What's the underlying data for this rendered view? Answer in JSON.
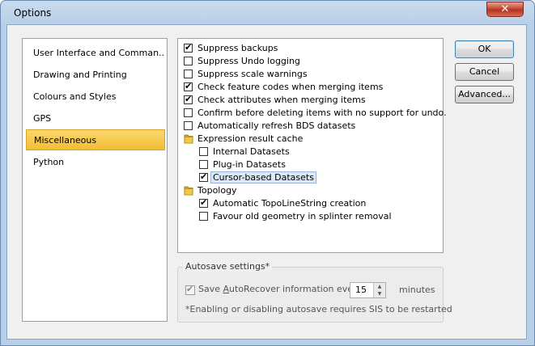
{
  "window": {
    "title": "Options",
    "close_glyph": "✕"
  },
  "nav": {
    "items": [
      {
        "label": "User Interface and Comman..."
      },
      {
        "label": "Drawing and Printing"
      },
      {
        "label": "Colours and Styles"
      },
      {
        "label": "GPS"
      },
      {
        "label": "Miscellaneous",
        "selected": true
      },
      {
        "label": "Python"
      }
    ]
  },
  "options": {
    "suppress_backups": {
      "label": "Suppress backups",
      "checked": true
    },
    "suppress_undo": {
      "label": "Suppress Undo logging",
      "checked": false
    },
    "suppress_scale": {
      "label": "Suppress scale warnings",
      "checked": false
    },
    "check_feature_codes": {
      "label": "Check feature codes when merging items",
      "checked": true
    },
    "check_attributes": {
      "label": "Check attributes when merging items",
      "checked": true
    },
    "confirm_delete": {
      "label": "Confirm before deleting items with no support for undo.",
      "checked": false
    },
    "refresh_bds": {
      "label": "Automatically refresh BDS datasets",
      "checked": false
    },
    "expression_cache": {
      "label": "Expression result cache",
      "icon": "folder-icon",
      "children": {
        "internal": {
          "label": "Internal Datasets",
          "checked": false
        },
        "plugin": {
          "label": "Plug-in Datasets",
          "checked": false
        },
        "cursor": {
          "label": "Cursor-based Datasets",
          "checked": true
        }
      }
    },
    "topology": {
      "label": "Topology",
      "icon": "folder-icon",
      "children": {
        "auto_topo": {
          "label": "Automatic TopoLineString creation",
          "checked": true
        },
        "favour_old": {
          "label": "Favour old geometry in splinter removal",
          "checked": false
        }
      }
    }
  },
  "buttons": {
    "ok": "OK",
    "cancel": "Cancel",
    "advanced": "Advanced..."
  },
  "autosave": {
    "title": "Autosave settings*",
    "label_before": "Save ",
    "label_access": "A",
    "label_rest": "utoRecover information every",
    "checked": true,
    "minutes_value": "15",
    "minutes_label": "minutes",
    "note": "*Enabling or disabling autosave requires SIS to be restarted"
  },
  "colors": {
    "selected_bg": "#f3bd34",
    "title_bg": "#b9cfe7",
    "close_bg": "#c64a35"
  }
}
